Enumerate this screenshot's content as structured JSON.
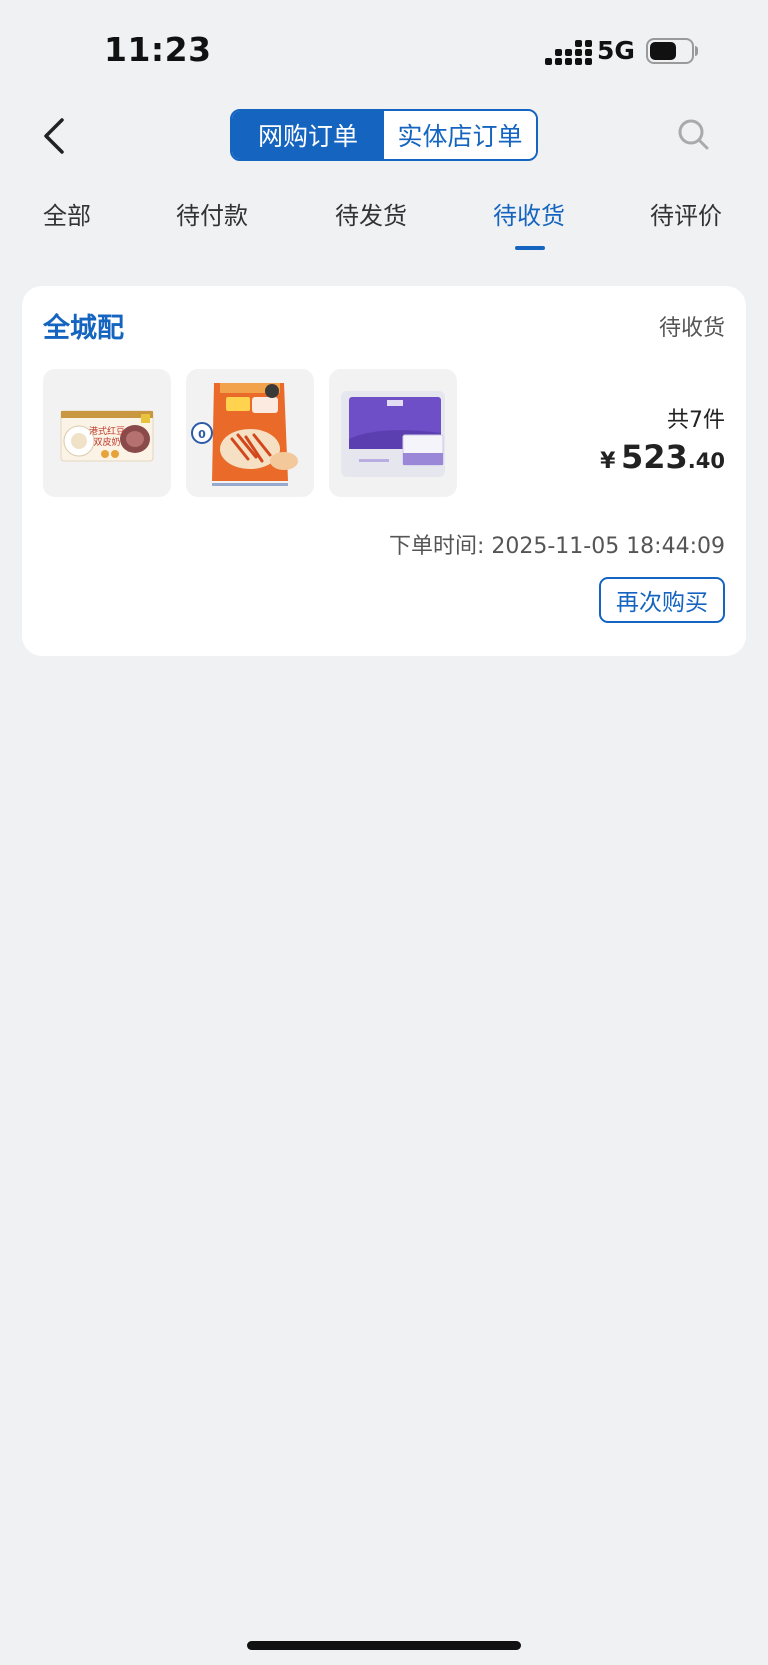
{
  "status_bar": {
    "time": "11:23",
    "network": "5G"
  },
  "header": {
    "segments": [
      {
        "label": "网购订单",
        "active": true
      },
      {
        "label": "实体店订单",
        "active": false
      }
    ]
  },
  "tabs": [
    {
      "label": "全部",
      "active": false
    },
    {
      "label": "待付款",
      "active": false
    },
    {
      "label": "待发货",
      "active": false
    },
    {
      "label": "待收货",
      "active": true
    },
    {
      "label": "待评价",
      "active": false
    }
  ],
  "order": {
    "type": "全城配",
    "status": "待收货",
    "quantity": "共7件",
    "price": {
      "currency": "¥",
      "integer": "523",
      "decimal": ".40"
    },
    "order_time": "下单时间: 2025-11-05 18:44:09",
    "rebuy_label": "再次购买",
    "products": [
      {
        "icon": "red-bean-milk-pudding-box",
        "box_text_1": "港式红豆",
        "box_text_2": "双皮奶"
      },
      {
        "icon": "orange-snack-bag",
        "badge": "0"
      },
      {
        "icon": "purple-tissue-pack"
      }
    ]
  },
  "colors": {
    "accent": "#1565c0",
    "background": "#f0f1f3",
    "card": "#ffffff"
  }
}
